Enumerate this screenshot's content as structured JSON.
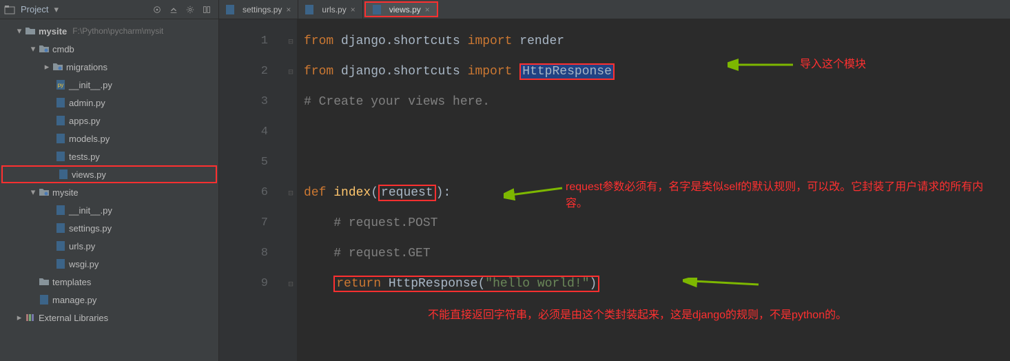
{
  "sidebar": {
    "title": "Project",
    "root": {
      "label": "mysite",
      "path": "F:\\Python\\pycharm\\mysit"
    },
    "cmdb": "cmdb",
    "migrations": "migrations",
    "files_cmdb": [
      "__init__.py",
      "admin.py",
      "apps.py",
      "models.py",
      "tests.py",
      "views.py"
    ],
    "mysite_pkg": "mysite",
    "files_mysite": [
      "__init__.py",
      "settings.py",
      "urls.py",
      "wsgi.py"
    ],
    "templates": "templates",
    "manage": "manage.py",
    "external": "External Libraries"
  },
  "tabs": [
    {
      "label": "settings.py",
      "active": false
    },
    {
      "label": "urls.py",
      "active": false
    },
    {
      "label": "views.py",
      "active": true
    }
  ],
  "code": {
    "line_numbers": [
      "1",
      "2",
      "3",
      "4",
      "5",
      "6",
      "7",
      "8",
      "9"
    ],
    "l1": {
      "from": "from",
      "mod": " django.shortcuts ",
      "import": "import",
      "name": " render"
    },
    "l2": {
      "from": "from",
      "mod": " django.shortcuts ",
      "import": "import",
      "name": "HttpResponse"
    },
    "l3": "# Create your views here.",
    "l6": {
      "def": "def ",
      "fn": "index",
      "lp": "(",
      "arg": "request",
      "rp": "):"
    },
    "l7": "# request.POST",
    "l8": "# request.GET",
    "l9": {
      "ret": "return ",
      "call": "HttpResponse(",
      "str": "\"hello world!\"",
      "rp": ")"
    }
  },
  "annotations": {
    "a1": "导入这个模块",
    "a2": "request参数必须有，名字是类似self的默认规则，可以改。它封装了用户请求的所有内容。",
    "a3": "不能直接返回字符串，必须是由这个类封装起来，这是django的规则，不是python的。"
  }
}
